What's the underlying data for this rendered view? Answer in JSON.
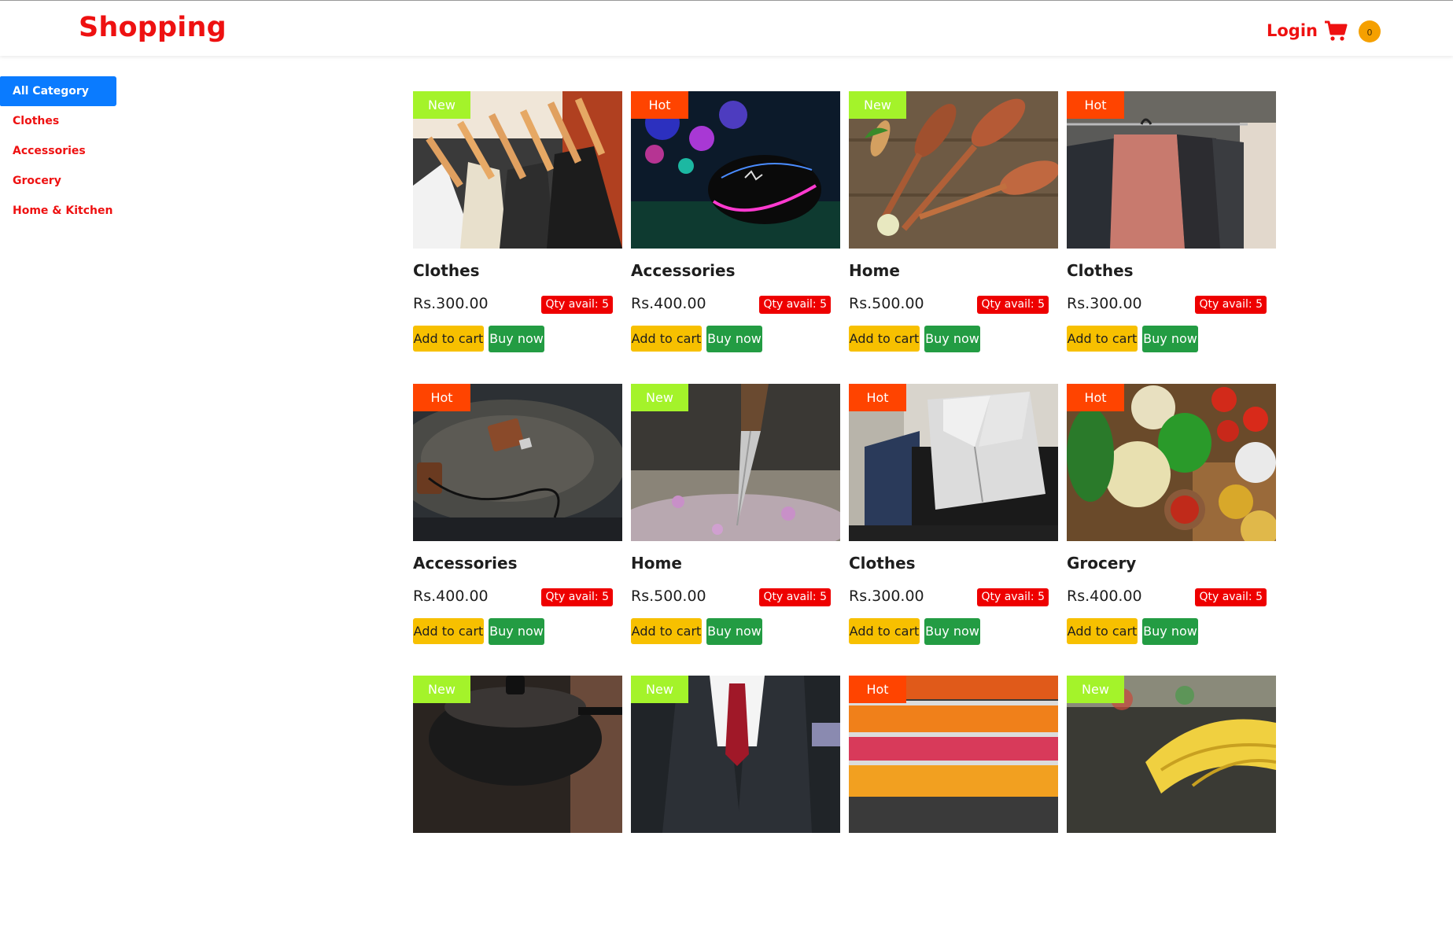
{
  "header": {
    "brand": "Shopping",
    "login_label": "Login",
    "cart_count": "0"
  },
  "colors": {
    "brand_red": "#ee1111",
    "active_blue": "#0a7bff",
    "badge_new": "#a4f32a",
    "badge_hot": "#ff4400",
    "add_to_cart": "#f7c000",
    "buy_now": "#239c43",
    "qty_badge": "#ee0000"
  },
  "sidebar": {
    "items": [
      {
        "label": "All Category",
        "active": true
      },
      {
        "label": "Clothes"
      },
      {
        "label": "Accessories"
      },
      {
        "label": "Grocery"
      },
      {
        "label": "Home & Kitchen"
      }
    ]
  },
  "buttons": {
    "add_to_cart": "Add to cart",
    "buy_now": "Buy now"
  },
  "products": [
    {
      "badge": "New",
      "name": "Clothes",
      "price": "Rs.300.00",
      "qty": "Qty avail: 5",
      "image": "hanging-shirts"
    },
    {
      "badge": "Hot",
      "name": "Accessories",
      "price": "Rs.400.00",
      "qty": "Qty avail: 5",
      "image": "gaming-mouse"
    },
    {
      "badge": "New",
      "name": "Home",
      "price": "Rs.500.00",
      "qty": "Qty avail: 5",
      "image": "wooden-spoons"
    },
    {
      "badge": "Hot",
      "name": "Clothes",
      "price": "Rs.300.00",
      "qty": "Qty avail: 5",
      "image": "closet-shirts"
    },
    {
      "badge": "Hot",
      "name": "Accessories",
      "price": "Rs.400.00",
      "qty": "Qty avail: 5",
      "image": "wooden-usb"
    },
    {
      "badge": "New",
      "name": "Home",
      "price": "Rs.500.00",
      "qty": "Qty avail: 5",
      "image": "pocket-knife"
    },
    {
      "badge": "Hot",
      "name": "Clothes",
      "price": "Rs.300.00",
      "qty": "Qty avail: 5",
      "image": "folded-shirt"
    },
    {
      "badge": "Hot",
      "name": "Grocery",
      "price": "Rs.400.00",
      "qty": "Qty avail: 5",
      "image": "vegetables"
    },
    {
      "badge": "New",
      "image": "cooking-pot"
    },
    {
      "badge": "New",
      "image": "suit-tie"
    },
    {
      "badge": "Hot",
      "image": "fruit-market"
    },
    {
      "badge": "New",
      "image": "bananas"
    }
  ]
}
